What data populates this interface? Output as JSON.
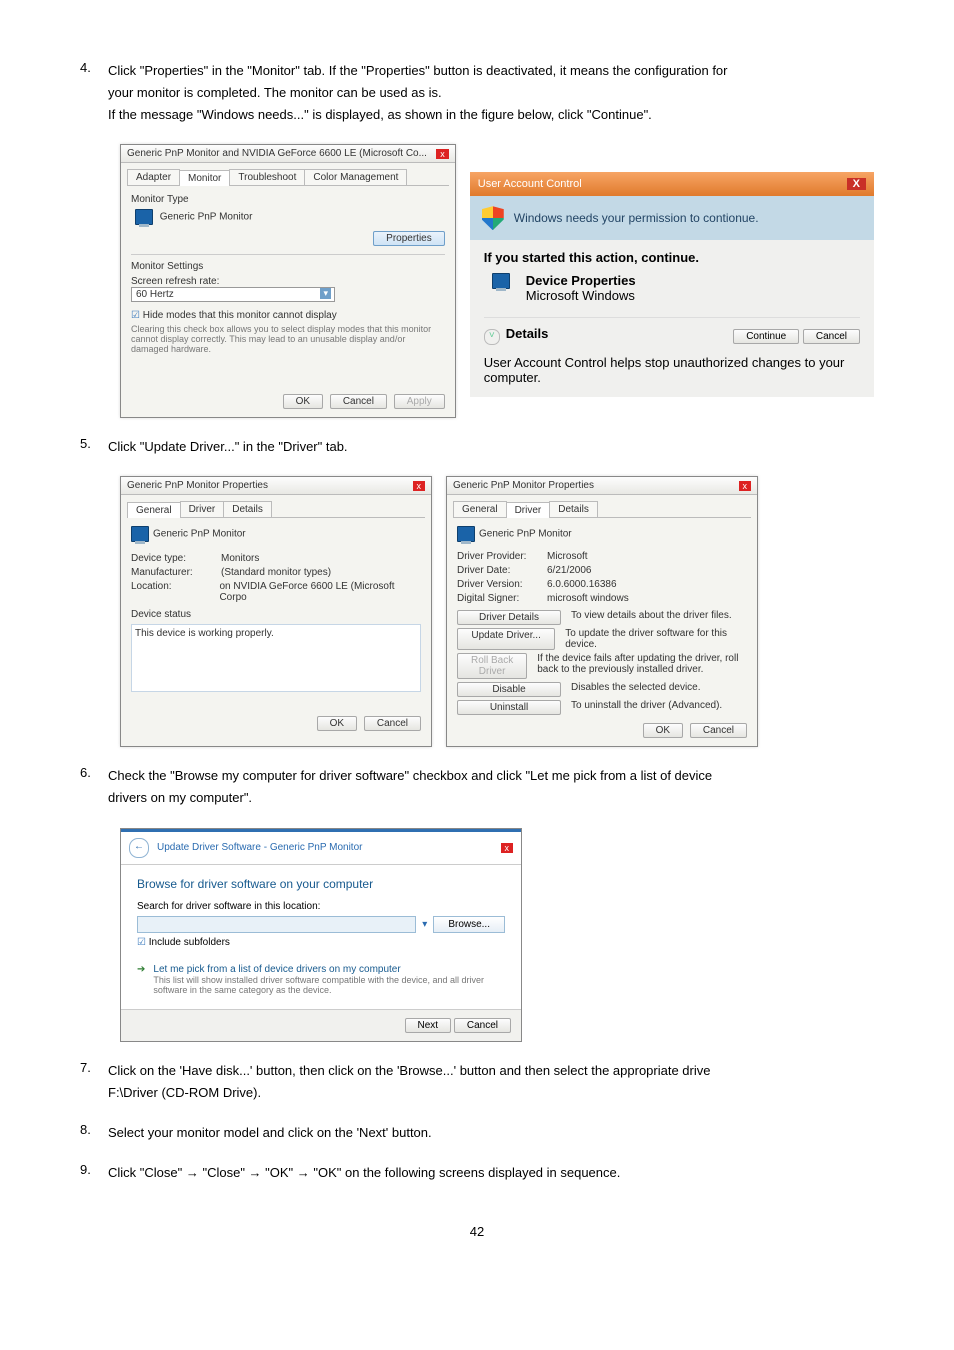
{
  "steps": {
    "s4": {
      "num": "4.",
      "line1": "Click \"Properties\" in the \"Monitor\" tab. If the \"Properties\" button is deactivated, it means the configuration for",
      "line2": "your monitor is completed. The monitor can be used as is.",
      "line3": "If the message \"Windows needs...\" is displayed, as shown in the figure below, click \"Continue\"."
    },
    "s5": {
      "num": "5.",
      "text": "Click \"Update Driver...\" in the \"Driver\" tab."
    },
    "s6": {
      "num": "6.",
      "line1": "Check the \"Browse my computer for driver software\" checkbox and click \"Let me pick from a list of device",
      "line2": "drivers on my computer\"."
    },
    "s7": {
      "num": "7.",
      "line1": "Click on the 'Have disk...' button, then click on the 'Browse...' button and then select the appropriate drive",
      "line2": "F:\\Driver (CD-ROM Drive)."
    },
    "s8": {
      "num": "8.",
      "text": "Select your monitor model and click on the 'Next' button."
    },
    "s9": {
      "num": "9.",
      "text": "Click \"Close\"  →  \"Close\"  →  \"OK\"  →  \"OK\" on the following screens displayed in sequence."
    }
  },
  "monitor_dialog": {
    "title": "Generic PnP Monitor and NVIDIA GeForce 6600 LE (Microsoft Co...",
    "tabs": [
      "Adapter",
      "Monitor",
      "Troubleshoot",
      "Color Management"
    ],
    "monitor_type_lbl": "Monitor Type",
    "monitor_name": "Generic PnP Monitor",
    "properties_btn": "Properties",
    "settings_lbl": "Monitor Settings",
    "refresh_lbl": "Screen refresh rate:",
    "refresh_val": "60 Hertz",
    "hide_modes": "Hide modes that this monitor cannot display",
    "warn": "Clearing this check box allows you to select display modes that this monitor cannot display correctly. This may lead to an unusable display and/or damaged hardware.",
    "ok": "OK",
    "cancel": "Cancel",
    "apply": "Apply"
  },
  "uac": {
    "title": "User Account Control",
    "headline": "Windows needs your permission to contionue.",
    "started": "If you started this action, continue.",
    "dev_name": "Device Properties",
    "dev_vendor": "Microsoft Windows",
    "details": "Details",
    "continue": "Continue",
    "cancel": "Cancel",
    "footer": "User Account Control helps stop unauthorized changes to your computer."
  },
  "props_general": {
    "title": "Generic PnP Monitor Properties",
    "tabs": [
      "General",
      "Driver",
      "Details"
    ],
    "header": "Generic PnP Monitor",
    "fields": {
      "device_type_k": "Device type:",
      "device_type_v": "Monitors",
      "manufacturer_k": "Manufacturer:",
      "manufacturer_v": "(Standard monitor types)",
      "location_k": "Location:",
      "location_v": "on NVIDIA GeForce 6600 LE (Microsoft Corpo"
    },
    "status_lbl": "Device status",
    "status_text": "This device is working properly.",
    "ok": "OK",
    "cancel": "Cancel"
  },
  "props_driver": {
    "title": "Generic PnP Monitor Properties",
    "tabs": [
      "General",
      "Driver",
      "Details"
    ],
    "header": "Generic PnP Monitor",
    "rows": {
      "provider_k": "Driver Provider:",
      "provider_v": "Microsoft",
      "date_k": "Driver Date:",
      "date_v": "6/21/2006",
      "version_k": "Driver Version:",
      "version_v": "6.0.6000.16386",
      "signer_k": "Digital Signer:",
      "signer_v": "microsoft windows"
    },
    "buttons": {
      "details": "Driver Details",
      "details_d": "To view details about the driver files.",
      "update": "Update Driver...",
      "update_d": "To update the driver software for this device.",
      "rollback": "Roll Back Driver",
      "rollback_d": "If the device fails after updating the driver, roll back to the previously installed driver.",
      "disable": "Disable",
      "disable_d": "Disables the selected device.",
      "uninstall": "Uninstall",
      "uninstall_d": "To uninstall the driver (Advanced)."
    },
    "ok": "OK",
    "cancel": "Cancel"
  },
  "wizard": {
    "breadcrumb": "Update Driver Software - Generic PnP Monitor",
    "heading": "Browse for driver software on your computer",
    "search_lbl": "Search for driver software in this location:",
    "path_placeholder": "",
    "browse": "Browse...",
    "include": "Include subfolders",
    "opt_title": "Let me pick from a list of device drivers on my computer",
    "opt_desc": "This list will show installed driver software compatible with the device, and all driver software in the same category as the device.",
    "next": "Next",
    "cancel": "Cancel"
  },
  "page_number": "42"
}
